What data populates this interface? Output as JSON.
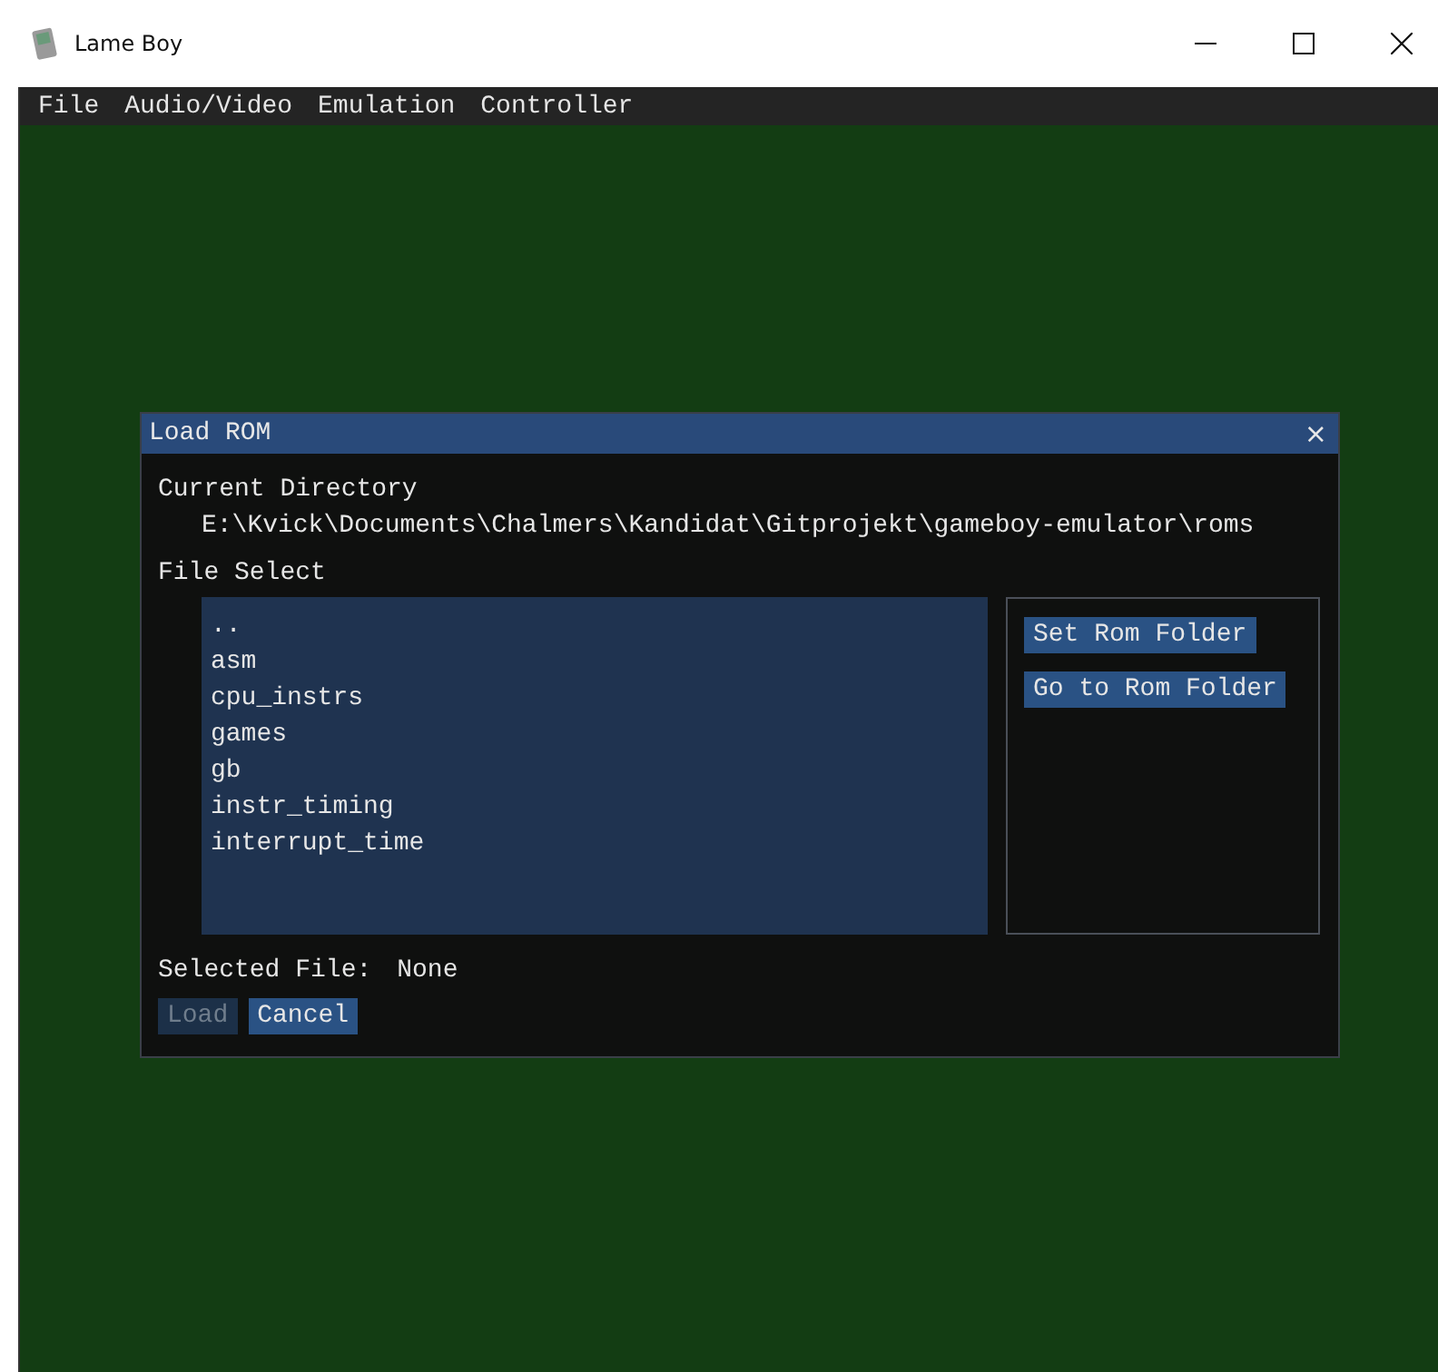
{
  "window": {
    "title": "Lame Boy"
  },
  "menu": [
    "File",
    "Audio/Video",
    "Emulation",
    "Controller"
  ],
  "dialog": {
    "title": "Load ROM",
    "close": "×",
    "current_directory_label": "Current Directory",
    "current_directory": "E:\\Kvick\\Documents\\Chalmers\\Kandidat\\Gitprojekt\\gameboy-emulator\\roms",
    "file_select_label": "File Select",
    "files": [
      {
        "name": "..",
        "selected": false
      },
      {
        "name": "asm",
        "selected": false
      },
      {
        "name": "cpu_instrs",
        "selected": false
      },
      {
        "name": "games",
        "selected": false
      },
      {
        "name": "gb",
        "selected": false
      },
      {
        "name": "instr_timing",
        "selected": false
      },
      {
        "name": "interrupt_time",
        "selected": false
      }
    ],
    "side_buttons": [
      "Set Rom Folder",
      "Go to Rom Folder"
    ],
    "selected_file_label": "Selected File:",
    "selected_file": "None",
    "buttons": [
      {
        "label": "Load",
        "disabled": true
      },
      {
        "label": "Cancel",
        "disabled": false
      }
    ]
  }
}
